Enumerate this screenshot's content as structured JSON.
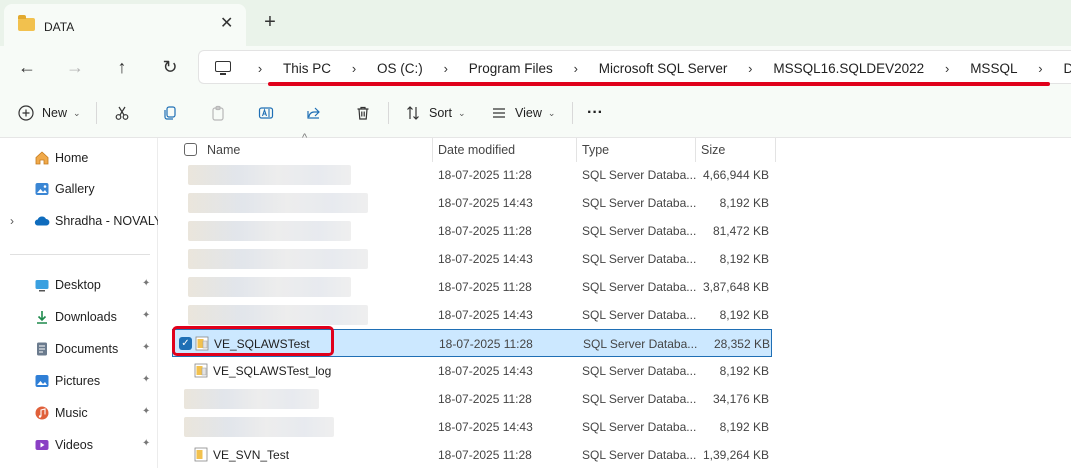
{
  "window": {
    "tab_title": "DATA",
    "close_glyph": "✕",
    "new_tab_glyph": "+"
  },
  "nav": {
    "back_glyph": "←",
    "forward_glyph": "→",
    "up_glyph": "↑",
    "refresh_glyph": "↻"
  },
  "breadcrumb": {
    "separator": "›",
    "items": [
      "This PC",
      "OS (C:)",
      "Program Files",
      "Microsoft SQL Server",
      "MSSQL16.SQLDEV2022",
      "MSSQL",
      "DATA"
    ]
  },
  "toolbar": {
    "new_label": "New",
    "sort_label": "Sort",
    "view_label": "View",
    "more_glyph": "···",
    "chevron_glyph": "⌄"
  },
  "sidebar": {
    "items": [
      {
        "label": "Home",
        "icon": "home-icon"
      },
      {
        "label": "Gallery",
        "icon": "gallery-icon"
      },
      {
        "label": "Shradha - NOVALYS",
        "icon": "onedrive-cloud-icon"
      },
      {
        "label": "Desktop",
        "icon": "desktop-icon"
      },
      {
        "label": "Downloads",
        "icon": "downloads-icon"
      },
      {
        "label": "Documents",
        "icon": "documents-icon"
      },
      {
        "label": "Pictures",
        "icon": "pictures-icon"
      },
      {
        "label": "Music",
        "icon": "music-icon"
      },
      {
        "label": "Videos",
        "icon": "videos-icon"
      }
    ],
    "pin_glyph": "📌"
  },
  "columns": {
    "name": "Name",
    "date": "Date modified",
    "type": "Type",
    "size": "Size"
  },
  "files": [
    {
      "name": "",
      "date": "18-07-2025 11:28",
      "type": "SQL Server Databa...",
      "size": "4,66,944 KB"
    },
    {
      "name": "",
      "date": "18-07-2025 14:43",
      "type": "SQL Server Databa...",
      "size": "8,192 KB"
    },
    {
      "name": "",
      "date": "18-07-2025 11:28",
      "type": "SQL Server Databa...",
      "size": "81,472 KB"
    },
    {
      "name": "",
      "date": "18-07-2025 14:43",
      "type": "SQL Server Databa...",
      "size": "8,192 KB"
    },
    {
      "name": "",
      "date": "18-07-2025 11:28",
      "type": "SQL Server Databa...",
      "size": "3,87,648 KB"
    },
    {
      "name": "",
      "date": "18-07-2025 14:43",
      "type": "SQL Server Databa...",
      "size": "8,192 KB"
    },
    {
      "name": "VE_SQLAWSTest",
      "date": "18-07-2025 11:28",
      "type": "SQL Server Databa...",
      "size": "28,352 KB"
    },
    {
      "name": "VE_SQLAWSTest_log",
      "date": "18-07-2025 14:43",
      "type": "SQL Server Databa...",
      "size": "8,192 KB"
    },
    {
      "name": "",
      "date": "18-07-2025 11:28",
      "type": "SQL Server Databa...",
      "size": "34,176 KB"
    },
    {
      "name": "",
      "date": "18-07-2025 14:43",
      "type": "SQL Server Databa...",
      "size": "8,192 KB"
    },
    {
      "name": "VE_SVN_Test",
      "date": "18-07-2025 11:28",
      "type": "SQL Server Databa...",
      "size": "1,39,264 KB"
    }
  ],
  "colors": {
    "accent": "#1f6fb5",
    "selection": "#cce8ff",
    "annotation_red": "#e0001b",
    "folder_yellow": "#f2c14e"
  }
}
